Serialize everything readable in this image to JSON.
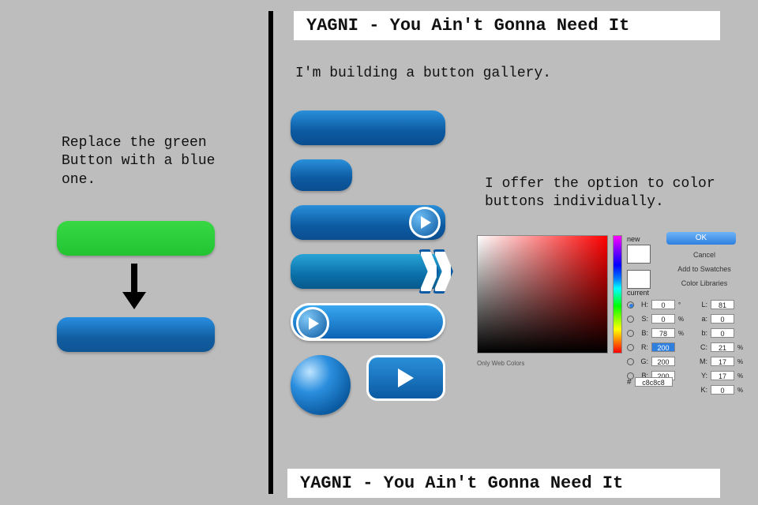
{
  "left": {
    "instruction": "Replace the green Button with a blue one."
  },
  "right": {
    "title": "YAGNI - You Ain't Gonna Need It",
    "gallery_caption": "I'm building a button gallery.",
    "option_caption": "I offer the option to color buttons individually."
  },
  "picker": {
    "ok": "OK",
    "cancel": "Cancel",
    "add_swatch": "Add to Swatches",
    "libraries": "Color Libraries",
    "only_web": "Only Web Colors",
    "new_label": "new",
    "current_label": "current",
    "hex": "c8c8c8",
    "hsb": {
      "H": "0",
      "S": "0",
      "B": "78"
    },
    "rgb": {
      "R": "200",
      "G": "200",
      "B": "200"
    },
    "lab": {
      "L": "81",
      "a": "0",
      "b": "0"
    },
    "cmyk": {
      "C": "21",
      "M": "17",
      "Y": "17",
      "K": "0"
    },
    "units": {
      "deg": "°",
      "pct": "%"
    }
  }
}
